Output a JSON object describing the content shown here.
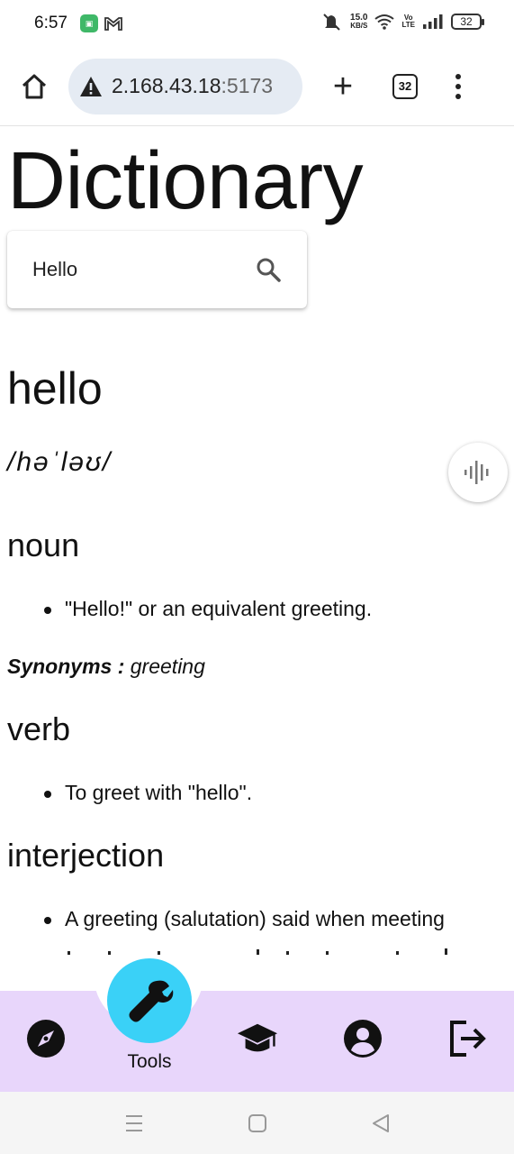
{
  "status_bar": {
    "time": "6:57",
    "net_speed_value": "15.0",
    "net_speed_unit": "KB/S",
    "volte_top": "Vo",
    "volte_bottom": "LTE",
    "battery": "32"
  },
  "browser": {
    "url_host": "2.168.43.18",
    "url_port": ":5173",
    "tab_count": "32",
    "new_tab_label": "+"
  },
  "page": {
    "title": "Dictionary",
    "search": {
      "value": "Hello"
    },
    "word": "hello",
    "phonetic": "/həˈləʊ/",
    "meanings": [
      {
        "part_of_speech": "noun",
        "definitions": [
          "\"Hello!\" or an equivalent greeting."
        ]
      },
      {
        "part_of_speech": "verb",
        "definitions": [
          "To greet with \"hello\"."
        ]
      },
      {
        "part_of_speech": "interjection",
        "definitions": [
          "A greeting (salutation) said when meeting"
        ]
      }
    ],
    "synonyms_label": "Synonyms :",
    "synonyms_value": "greeting"
  },
  "bottom_nav": {
    "active_label": "Tools",
    "items": [
      {
        "icon": "compass-icon"
      },
      {
        "icon": "wrench-icon",
        "label": "Tools"
      },
      {
        "icon": "graduation-cap-icon"
      },
      {
        "icon": "account-icon"
      },
      {
        "icon": "logout-icon"
      }
    ]
  },
  "colors": {
    "nav_background": "#e8d6fb",
    "fab": "#3ad1f7",
    "url_pill": "#e5ebf3"
  }
}
